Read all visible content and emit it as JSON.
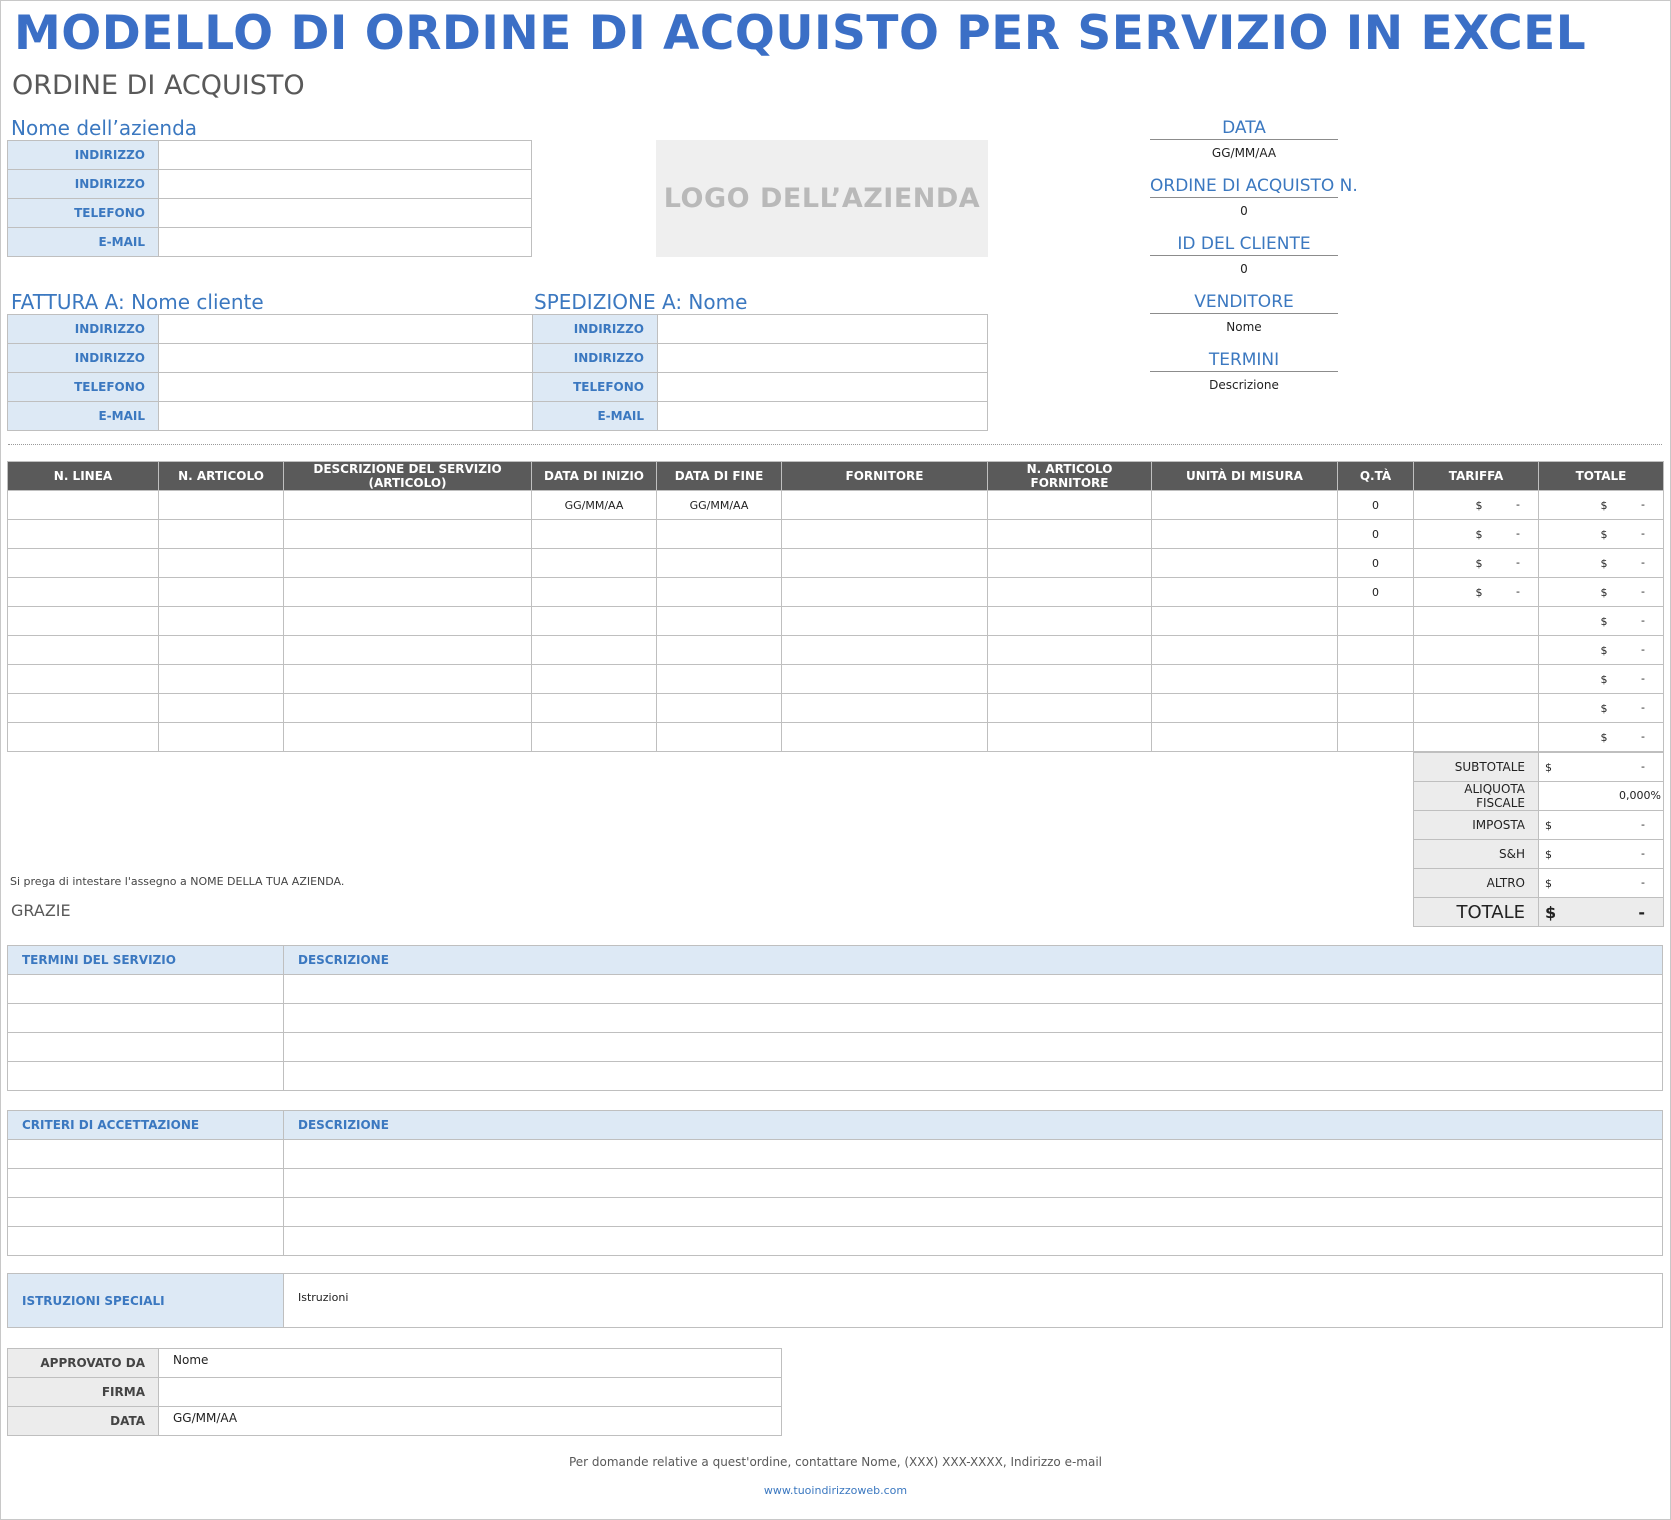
{
  "title": "MODELLO DI ORDINE DI ACQUISTO PER SERVIZIO IN EXCEL",
  "subtitle": "ORDINE DI ACQUISTO",
  "company": {
    "name": "Nome dell’azienda",
    "labels": [
      "INDIRIZZO",
      "INDIRIZZO",
      "TELEFONO",
      "E-MAIL"
    ],
    "logo": "LOGO DELL’AZIENDA"
  },
  "bill_to": {
    "heading": "FATTURA A: Nome cliente",
    "labels": [
      "INDIRIZZO",
      "INDIRIZZO",
      "TELEFONO",
      "E-MAIL"
    ]
  },
  "ship_to": {
    "heading": "SPEDIZIONE A: Nome",
    "labels": [
      "INDIRIZZO",
      "INDIRIZZO",
      "TELEFONO",
      "E-MAIL"
    ]
  },
  "meta": [
    {
      "label": "DATA",
      "value": "GG/MM/AA"
    },
    {
      "label": "ORDINE DI ACQUISTO N.",
      "value": "0"
    },
    {
      "label": "ID DEL CLIENTE",
      "value": "0"
    },
    {
      "label": "VENDITORE",
      "value": "Nome"
    },
    {
      "label": "TERMINI",
      "value": "Descrizione"
    }
  ],
  "items": {
    "headers": [
      "N. LINEA",
      "N. ARTICOLO",
      "DESCRIZIONE DEL SERVIZIO (ARTICOLO)",
      "DATA DI INIZIO",
      "DATA DI FINE",
      "FORNITORE",
      "N. ARTICOLO FORNITORE",
      "UNITÀ DI MISURA",
      "Q.TÀ",
      "TARIFFA",
      "TOTALE"
    ],
    "rows": [
      {
        "start": "GG/MM/AA",
        "end": "GG/MM/AA",
        "qty": "0",
        "rate_cur": "$",
        "rate": "-",
        "total_cur": "$",
        "total": "-"
      },
      {
        "start": "",
        "end": "",
        "qty": "0",
        "rate_cur": "$",
        "rate": "-",
        "total_cur": "$",
        "total": "-"
      },
      {
        "start": "",
        "end": "",
        "qty": "0",
        "rate_cur": "$",
        "rate": "-",
        "total_cur": "$",
        "total": "-"
      },
      {
        "start": "",
        "end": "",
        "qty": "0",
        "rate_cur": "$",
        "rate": "-",
        "total_cur": "$",
        "total": "-"
      },
      {
        "start": "",
        "end": "",
        "qty": "",
        "rate_cur": "",
        "rate": "",
        "total_cur": "$",
        "total": "-"
      },
      {
        "start": "",
        "end": "",
        "qty": "",
        "rate_cur": "",
        "rate": "",
        "total_cur": "$",
        "total": "-"
      },
      {
        "start": "",
        "end": "",
        "qty": "",
        "rate_cur": "",
        "rate": "",
        "total_cur": "$",
        "total": "-"
      },
      {
        "start": "",
        "end": "",
        "qty": "",
        "rate_cur": "",
        "rate": "",
        "total_cur": "$",
        "total": "-"
      },
      {
        "start": "",
        "end": "",
        "qty": "",
        "rate_cur": "",
        "rate": "",
        "total_cur": "$",
        "total": "-"
      }
    ]
  },
  "totals": [
    {
      "label": "SUBTOTALE",
      "cur": "$",
      "value": "-"
    },
    {
      "label": "ALIQUOTA FISCALE",
      "cur": "",
      "value": "0,000%"
    },
    {
      "label": "IMPOSTA",
      "cur": "$",
      "value": "-"
    },
    {
      "label": "S&H",
      "cur": "$",
      "value": "-"
    },
    {
      "label": "ALTRO",
      "cur": "$",
      "value": "-"
    }
  ],
  "grand_total": {
    "label": "TOTALE",
    "cur": "$",
    "value": "-"
  },
  "note": "Si prega di intestare l'assegno a NOME DELLA TUA AZIENDA.",
  "thanks": "GRAZIE",
  "service_terms": {
    "col1": "TERMINI DEL SERVIZIO",
    "col2": "DESCRIZIONE"
  },
  "acceptance": {
    "col1": "CRITERI DI ACCETTAZIONE",
    "col2": "DESCRIZIONE"
  },
  "special": {
    "label": "ISTRUZIONI SPECIALI",
    "value": "Istruzioni"
  },
  "approval": [
    {
      "label": "APPROVATO DA",
      "value": "Nome"
    },
    {
      "label": "FIRMA",
      "value": ""
    },
    {
      "label": "DATA",
      "value": "GG/MM/AA"
    }
  ],
  "footer": {
    "contact": "Per domande relative a quest'ordine, contattare Nome, (XXX) XXX-XXXX, Indirizzo e-mail",
    "website": "www.tuoindirizzoweb.com"
  }
}
